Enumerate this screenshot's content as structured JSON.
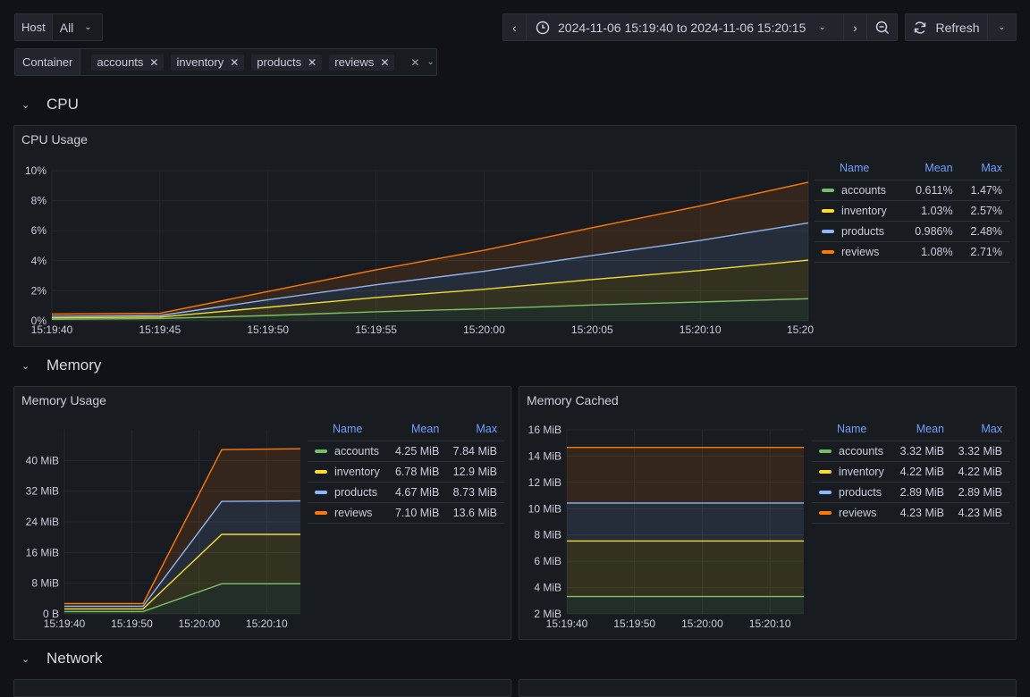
{
  "variables": {
    "host": {
      "label": "Host",
      "value": "All"
    },
    "container": {
      "label": "Container",
      "chips": [
        "accounts",
        "inventory",
        "products",
        "reviews"
      ]
    }
  },
  "timepicker": {
    "range": "2024-11-06 15:19:40 to 2024-11-06 15:20:15",
    "refresh_label": "Refresh"
  },
  "sections": {
    "cpu": "CPU",
    "memory": "Memory",
    "network": "Network"
  },
  "colors": {
    "accounts": "#73bf69",
    "inventory": "#fade2a",
    "products": "#8ab8ff",
    "reviews": "#ff780a",
    "legend_header": "#6e9fff"
  },
  "legend_headers": {
    "name": "Name",
    "mean": "Mean",
    "max": "Max"
  },
  "chart_data": [
    {
      "id": "cpu_usage",
      "type": "area",
      "stacked": true,
      "title": "CPU Usage",
      "x": [
        "15:19:40",
        "15:19:45",
        "15:19:50",
        "15:19:55",
        "15:20:00",
        "15:20:05",
        "15:20:10",
        "15:20:15"
      ],
      "x_ticks": [
        "15:19:40",
        "15:19:45",
        "15:19:50",
        "15:19:55",
        "15:20:00",
        "15:20:05",
        "15:20:10",
        "15:20"
      ],
      "y_ticks": [
        "0%",
        "2%",
        "4%",
        "6%",
        "8%",
        "10%"
      ],
      "ylim": [
        0,
        10
      ],
      "grid": true,
      "legend_placement": "right",
      "series": [
        {
          "name": "accounts",
          "values": [
            0.1,
            0.15,
            0.35,
            0.6,
            0.8,
            1.05,
            1.25,
            1.47
          ],
          "mean": "0.611%",
          "max": "1.47%"
        },
        {
          "name": "inventory",
          "values": [
            0.1,
            0.1,
            0.55,
            0.95,
            1.3,
            1.7,
            2.1,
            2.57
          ],
          "mean": "1.03%",
          "max": "2.57%"
        },
        {
          "name": "products",
          "values": [
            0.1,
            0.1,
            0.5,
            0.85,
            1.2,
            1.6,
            2.0,
            2.48
          ],
          "mean": "0.986%",
          "max": "2.48%"
        },
        {
          "name": "reviews",
          "values": [
            0.15,
            0.15,
            0.55,
            1.0,
            1.4,
            1.85,
            2.3,
            2.71
          ],
          "mean": "1.08%",
          "max": "2.71%"
        }
      ]
    },
    {
      "id": "memory_usage",
      "type": "area",
      "stacked": true,
      "title": "Memory Usage",
      "x": [
        "15:19:40",
        "15:19:45",
        "15:20:00",
        "15:20:15"
      ],
      "x_ticks": [
        "15:19:40",
        "15:19:50",
        "15:20:00",
        "15:20:10"
      ],
      "y_ticks": [
        "0 B",
        "8 MiB",
        "16 MiB",
        "24 MiB",
        "32 MiB",
        "40 MiB"
      ],
      "ylim": [
        0,
        48
      ],
      "grid": true,
      "legend_placement": "right",
      "series": [
        {
          "name": "accounts",
          "values": [
            0.6,
            0.6,
            7.84,
            7.84
          ],
          "mean": "4.25 MiB",
          "max": "7.84 MiB"
        },
        {
          "name": "inventory",
          "values": [
            0.7,
            0.7,
            12.9,
            12.9
          ],
          "mean": "6.78 MiB",
          "max": "12.9 MiB"
        },
        {
          "name": "products",
          "values": [
            0.7,
            0.7,
            8.6,
            8.73
          ],
          "mean": "4.67 MiB",
          "max": "8.73 MiB"
        },
        {
          "name": "reviews",
          "values": [
            0.7,
            0.7,
            13.5,
            13.6
          ],
          "mean": "7.10 MiB",
          "max": "13.6 MiB"
        }
      ]
    },
    {
      "id": "memory_cached",
      "type": "area",
      "stacked": true,
      "title": "Memory Cached",
      "x": [
        "15:19:40",
        "15:20:15"
      ],
      "x_ticks": [
        "15:19:40",
        "15:19:50",
        "15:20:00",
        "15:20:10"
      ],
      "y_ticks": [
        "2 MiB",
        "4 MiB",
        "6 MiB",
        "8 MiB",
        "10 MiB",
        "12 MiB",
        "14 MiB",
        "16 MiB"
      ],
      "ylim": [
        2,
        16
      ],
      "baseline": 0,
      "grid": true,
      "legend_placement": "right",
      "series": [
        {
          "name": "accounts",
          "values": [
            3.32,
            3.32
          ],
          "mean": "3.32 MiB",
          "max": "3.32 MiB"
        },
        {
          "name": "inventory",
          "values": [
            4.22,
            4.22
          ],
          "mean": "4.22 MiB",
          "max": "4.22 MiB"
        },
        {
          "name": "products",
          "values": [
            2.89,
            2.89
          ],
          "mean": "2.89 MiB",
          "max": "2.89 MiB"
        },
        {
          "name": "reviews",
          "values": [
            4.23,
            4.23
          ],
          "mean": "4.23 MiB",
          "max": "4.23 MiB"
        }
      ]
    }
  ]
}
